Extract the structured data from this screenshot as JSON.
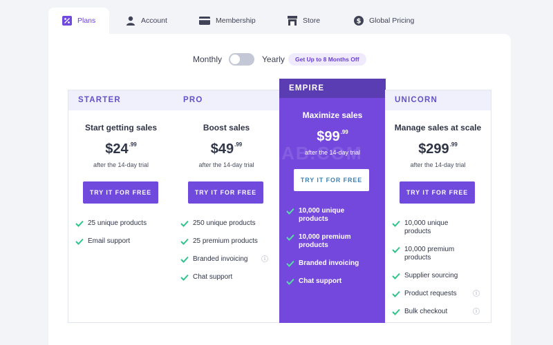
{
  "tabs": [
    {
      "label": "Plans",
      "icon": "percent-tag-icon",
      "active": true
    },
    {
      "label": "Account",
      "icon": "user-icon"
    },
    {
      "label": "Membership",
      "icon": "credit-card-icon"
    },
    {
      "label": "Store",
      "icon": "storefront-icon"
    },
    {
      "label": "Global Pricing",
      "icon": "dollar-circle-icon"
    }
  ],
  "billing": {
    "monthly_label": "Monthly",
    "yearly_label": "Yearly",
    "yearly_selected": false,
    "discount_badge": "Get Up to 8 Months Off"
  },
  "plans": [
    {
      "name": "STARTER",
      "tagline": "Start getting sales",
      "price": "$24",
      "cents": ".99",
      "trial": "after the 14-day trial",
      "cta": "TRY IT FOR FREE",
      "features": [
        {
          "text": "25 unique products"
        },
        {
          "text": "Email support"
        }
      ]
    },
    {
      "name": "PRO",
      "tagline": "Boost sales",
      "price": "$49",
      "cents": ".99",
      "trial": "after the 14-day trial",
      "cta": "TRY IT FOR FREE",
      "features": [
        {
          "text": "250 unique products"
        },
        {
          "text": "25 premium products"
        },
        {
          "text": "Branded invoicing",
          "info": true
        },
        {
          "text": "Chat support"
        }
      ]
    },
    {
      "name": "EMPIRE",
      "tagline": "Maximize sales",
      "price": "$99",
      "cents": ".99",
      "trial": "after the 14-day trial",
      "cta": "TRY IT FOR FREE",
      "featured": true,
      "features": [
        {
          "text": "10,000 unique products"
        },
        {
          "text": "10,000 premium products"
        },
        {
          "text": "Branded invoicing"
        },
        {
          "text": "Chat support"
        }
      ]
    },
    {
      "name": "UNICORN",
      "tagline": "Manage sales at scale",
      "price": "$299",
      "cents": ".99",
      "trial": "after the 14-day trial",
      "cta": "TRY IT FOR FREE",
      "features": [
        {
          "text": "10,000 unique products"
        },
        {
          "text": "10,000 premium products"
        },
        {
          "text": "Supplier sourcing"
        },
        {
          "text": "Product requests",
          "info": true
        },
        {
          "text": "Bulk checkout",
          "info": true
        }
      ]
    }
  ],
  "watermark": "ALIXLAB.COM",
  "colors": {
    "accent": "#7049dd",
    "featured_bg": "#7448dc",
    "featured_head": "#5a3cb3",
    "check": "#2fc489",
    "plan_head_bg": "#eff0fc"
  }
}
